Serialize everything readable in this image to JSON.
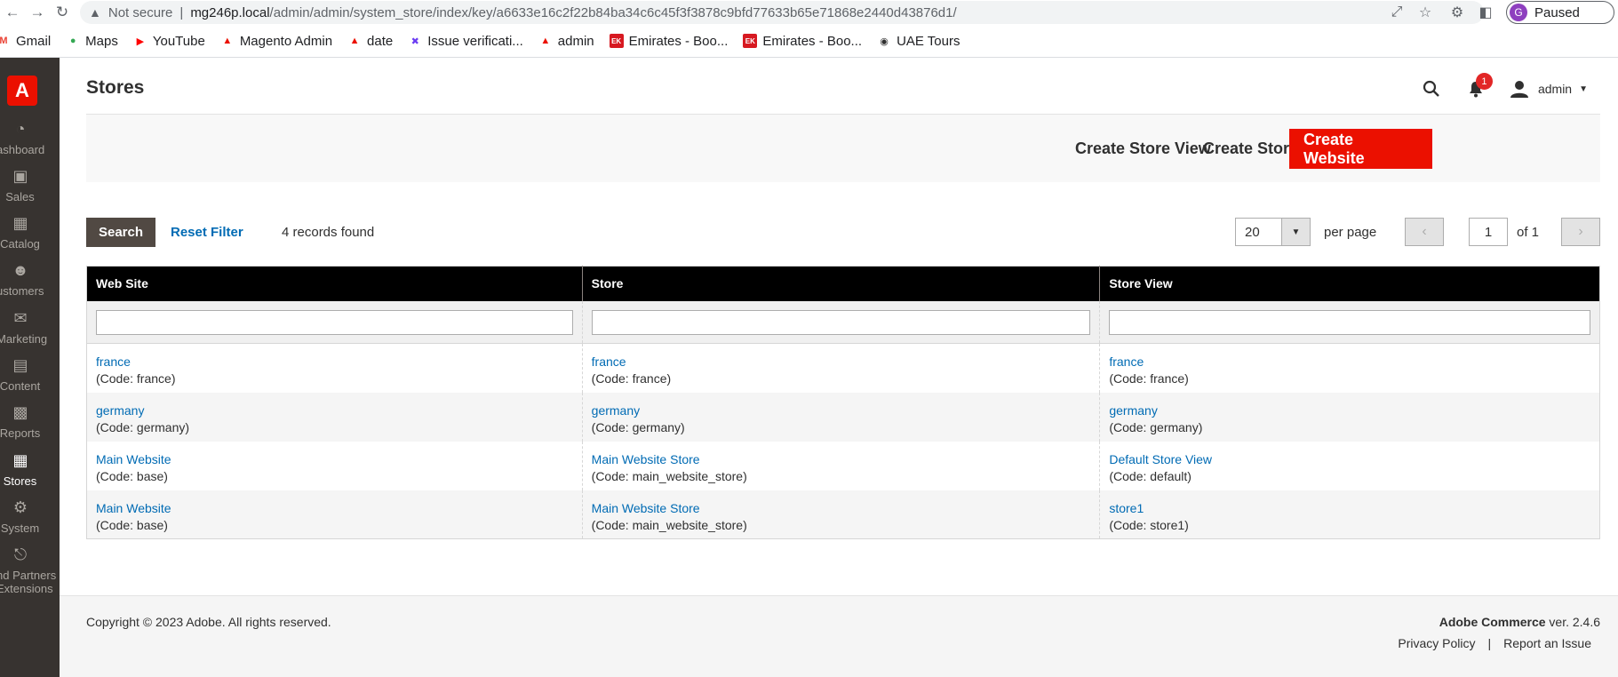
{
  "browser": {
    "security_label": "Not secure",
    "url_host": "mg246p.local",
    "url_path": "/admin/admin/system_store/index/key/a6633e16c2f22b84ba34c6c45f3f3878c9bfd77633b65e71868e2440d43876d1/",
    "profile_initial": "G",
    "profile_status": "Paused",
    "bookmarks": [
      {
        "label": "Gmail",
        "icon": "gmail-icon",
        "color": "#ea4335"
      },
      {
        "label": "Maps",
        "icon": "maps-icon",
        "color": "#34a853"
      },
      {
        "label": "YouTube",
        "icon": "youtube-icon",
        "color": "#ff0000"
      },
      {
        "label": "Magento Admin",
        "icon": "magento-icon",
        "color": "#eb1000"
      },
      {
        "label": "date",
        "icon": "magento-icon",
        "color": "#eb1000"
      },
      {
        "label": "Issue verificati...",
        "icon": "jira-icon",
        "color": "#6b3cf2"
      },
      {
        "label": "admin",
        "icon": "magento-icon",
        "color": "#eb1000"
      },
      {
        "label": "Emirates - Boo...",
        "icon": "emirates-icon",
        "color": "#d71921"
      },
      {
        "label": "Emirates - Boo...",
        "icon": "emirates-icon",
        "color": "#d71921"
      },
      {
        "label": "UAE Tours",
        "icon": "globe-icon",
        "color": "#303030"
      }
    ]
  },
  "sidebar": {
    "items": [
      {
        "label": "ashboard",
        "icon": "dashboard-icon"
      },
      {
        "label": "Sales",
        "icon": "sales-icon"
      },
      {
        "label": "Catalog",
        "icon": "catalog-icon"
      },
      {
        "label": "ustomers",
        "icon": "customers-icon"
      },
      {
        "label": "Marketing",
        "icon": "marketing-icon"
      },
      {
        "label": "Content",
        "icon": "content-icon"
      },
      {
        "label": "Reports",
        "icon": "reports-icon"
      },
      {
        "label": "Stores",
        "icon": "stores-icon"
      },
      {
        "label": "System",
        "icon": "system-icon"
      },
      {
        "label": "nd Partners",
        "label2": "Extensions",
        "icon": "partners-icon"
      }
    ]
  },
  "header": {
    "title": "Stores",
    "notification_count": "1",
    "user": "admin"
  },
  "actions": {
    "create_store_view": "Create Store View",
    "create_store": "Create Store",
    "create_website": "Create Website"
  },
  "grid": {
    "search_label": "Search",
    "reset_label": "Reset Filter",
    "records_found": "4 records found",
    "per_page_value": "20",
    "per_page_label": "per page",
    "page_current": "1",
    "page_total_label": "of 1",
    "columns": [
      "Web Site",
      "Store",
      "Store View"
    ],
    "rows": [
      {
        "website": "france",
        "website_code": "(Code: france)",
        "store": "france",
        "store_code": "(Code: france)",
        "view": "france",
        "view_code": "(Code: france)"
      },
      {
        "website": "germany",
        "website_code": "(Code: germany)",
        "store": "germany",
        "store_code": "(Code: germany)",
        "view": "germany",
        "view_code": "(Code: germany)"
      },
      {
        "website": "Main Website",
        "website_code": "(Code: base)",
        "store": "Main Website Store",
        "store_code": "(Code: main_website_store)",
        "view": "Default Store View",
        "view_code": "(Code: default)"
      },
      {
        "website": "Main Website",
        "website_code": "(Code: base)",
        "store": "Main Website Store",
        "store_code": "(Code: main_website_store)",
        "view": "store1",
        "view_code": "(Code: store1)"
      }
    ]
  },
  "footer": {
    "copyright": "Copyright © 2023 Adobe. All rights reserved.",
    "product": "Adobe Commerce",
    "version": "ver. 2.4.6",
    "privacy": "Privacy Policy",
    "divider": "|",
    "report": "Report an Issue"
  },
  "colors": {
    "accent": "#eb1000",
    "link": "#006bb4",
    "sidebar": "#373330"
  }
}
